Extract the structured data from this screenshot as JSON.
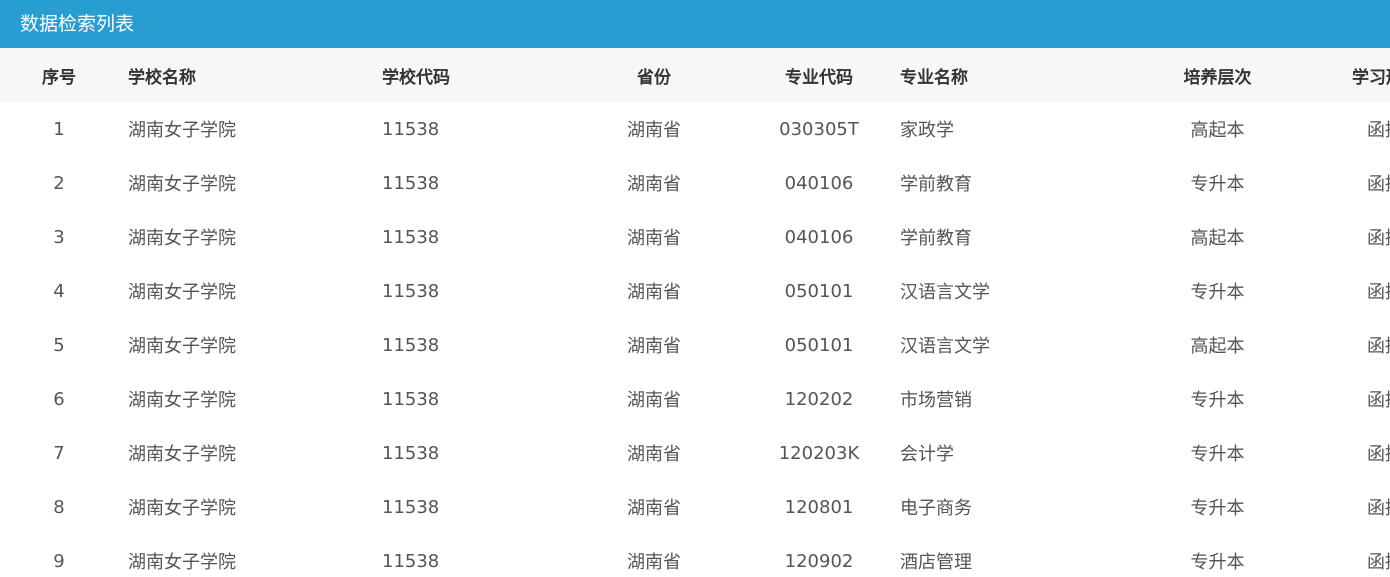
{
  "panel": {
    "title": "数据检索列表"
  },
  "table": {
    "headers": {
      "index": "序号",
      "school_name": "学校名称",
      "school_code": "学校代码",
      "province": "省份",
      "major_code": "专业代码",
      "major_name": "专业名称",
      "level": "培养层次",
      "study_form": "学习形式"
    },
    "rows": [
      {
        "index": "1",
        "school_name": "湖南女子学院",
        "school_code": "11538",
        "province": "湖南省",
        "major_code": "030305T",
        "major_name": "家政学",
        "level": "高起本",
        "study_form": "函授"
      },
      {
        "index": "2",
        "school_name": "湖南女子学院",
        "school_code": "11538",
        "province": "湖南省",
        "major_code": "040106",
        "major_name": "学前教育",
        "level": "专升本",
        "study_form": "函授"
      },
      {
        "index": "3",
        "school_name": "湖南女子学院",
        "school_code": "11538",
        "province": "湖南省",
        "major_code": "040106",
        "major_name": "学前教育",
        "level": "高起本",
        "study_form": "函授"
      },
      {
        "index": "4",
        "school_name": "湖南女子学院",
        "school_code": "11538",
        "province": "湖南省",
        "major_code": "050101",
        "major_name": "汉语言文学",
        "level": "专升本",
        "study_form": "函授"
      },
      {
        "index": "5",
        "school_name": "湖南女子学院",
        "school_code": "11538",
        "province": "湖南省",
        "major_code": "050101",
        "major_name": "汉语言文学",
        "level": "高起本",
        "study_form": "函授"
      },
      {
        "index": "6",
        "school_name": "湖南女子学院",
        "school_code": "11538",
        "province": "湖南省",
        "major_code": "120202",
        "major_name": "市场营销",
        "level": "专升本",
        "study_form": "函授"
      },
      {
        "index": "7",
        "school_name": "湖南女子学院",
        "school_code": "11538",
        "province": "湖南省",
        "major_code": "120203K",
        "major_name": "会计学",
        "level": "专升本",
        "study_form": "函授"
      },
      {
        "index": "8",
        "school_name": "湖南女子学院",
        "school_code": "11538",
        "province": "湖南省",
        "major_code": "120801",
        "major_name": "电子商务",
        "level": "专升本",
        "study_form": "函授"
      },
      {
        "index": "9",
        "school_name": "湖南女子学院",
        "school_code": "11538",
        "province": "湖南省",
        "major_code": "120902",
        "major_name": "酒店管理",
        "level": "专升本",
        "study_form": "函授"
      }
    ]
  },
  "colors": {
    "header_bar": "#279dd1",
    "table_head_bg": "#f7f7f7",
    "cell_text": "#555555"
  }
}
